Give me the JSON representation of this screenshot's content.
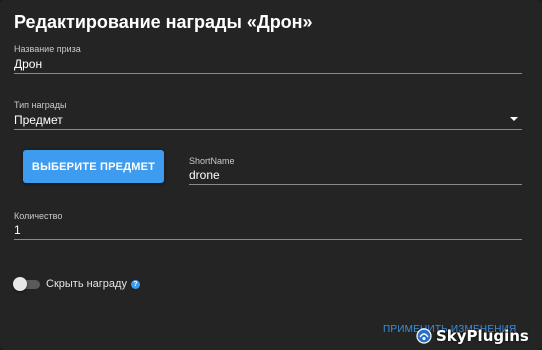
{
  "dialog": {
    "title": "Редактирование награды «Дрон»"
  },
  "fields": {
    "prize_name": {
      "label": "Название приза",
      "value": "Дрон"
    },
    "reward_type": {
      "label": "Тип награды",
      "value": "Предмет"
    },
    "short_name": {
      "label": "ShortName",
      "value": "drone"
    },
    "quantity": {
      "label": "Количество",
      "value": "1"
    }
  },
  "buttons": {
    "select_item": "ВЫБЕРИТЕ ПРЕДМЕТ",
    "apply_changes": "ПРИМЕНИТЬ ИЗМЕНЕНИЯ"
  },
  "toggle": {
    "label": "Скрыть награду",
    "checked": false,
    "help_icon": "question-circle-icon"
  },
  "watermark": {
    "text": "SkyPlugins",
    "icon": "sky-logo-icon"
  },
  "colors": {
    "accent": "#3d9cf0",
    "background": "#242424",
    "text": "#ffffff"
  }
}
